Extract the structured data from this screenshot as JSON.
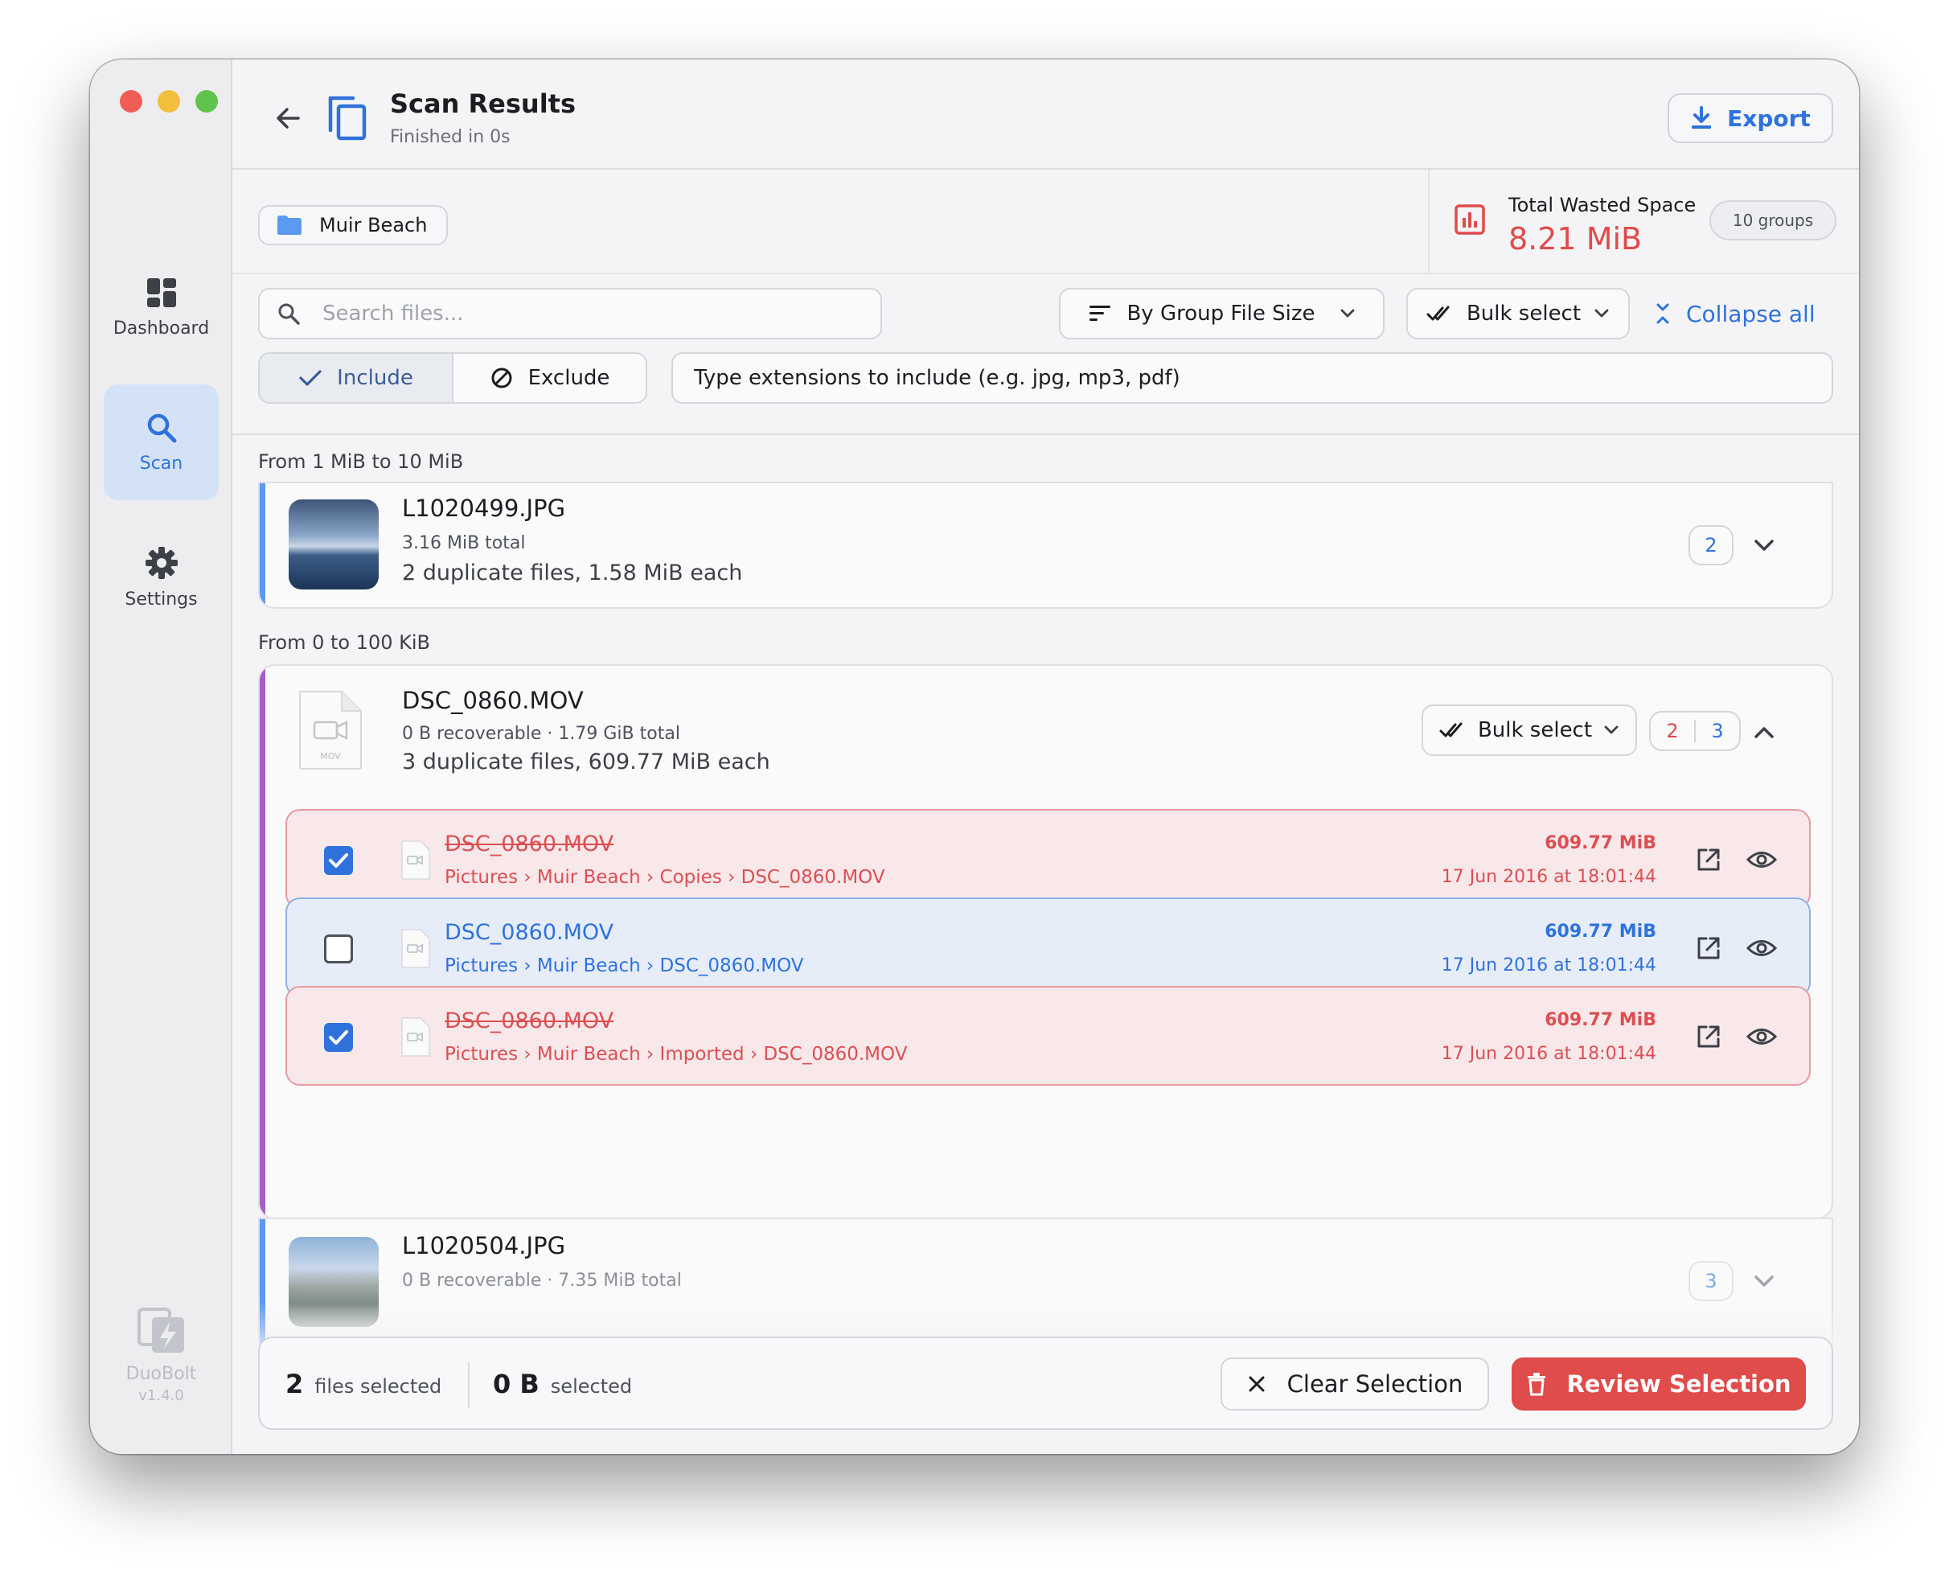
{
  "sidebar": {
    "items": [
      {
        "label": "Dashboard",
        "icon": "dashboard-icon"
      },
      {
        "label": "Scan",
        "icon": "search-icon"
      },
      {
        "label": "Settings",
        "icon": "gear-icon"
      }
    ],
    "brand": {
      "name": "DuoBolt",
      "version": "v1.4.0"
    }
  },
  "header": {
    "title": "Scan Results",
    "subtitle": "Finished in 0s",
    "export_label": "Export"
  },
  "info": {
    "folder": "Muir Beach",
    "wasted_label": "Total Wasted Space",
    "wasted_value": "8.21 MiB",
    "groups": "10 groups"
  },
  "controls": {
    "search_placeholder": "Search files...",
    "sort_label": "By Group File Size",
    "bulk_label": "Bulk select",
    "collapse_label": "Collapse all",
    "include_label": "Include",
    "exclude_label": "Exclude",
    "ext_placeholder": "Type extensions to include (e.g. jpg, mp3, pdf)"
  },
  "list": {
    "sections": [
      "From 1 MiB to 10 MiB",
      "From 0 to 100 KiB"
    ],
    "groups": [
      {
        "name": "L1020499.JPG",
        "meta": "3.16 MiB total",
        "sub": "2 duplicate files, 1.58 MiB each",
        "count": "2"
      },
      {
        "name": "DSC_0860.MOV",
        "meta": "0 B recoverable · 1.79 GiB total",
        "sub": "3 duplicate files, 609.77 MiB each",
        "bulk_label": "Bulk select",
        "count_red": "2",
        "count_blue": "3",
        "thumb_label": "MOV",
        "files": [
          {
            "name": "DSC_0860.MOV",
            "path": "Pictures › Muir Beach › Copies › DSC_0860.MOV",
            "size": "609.77 MiB",
            "date": "17 Jun 2016 at 18:01:44",
            "selected": true
          },
          {
            "name": "DSC_0860.MOV",
            "path": "Pictures › Muir Beach › DSC_0860.MOV",
            "size": "609.77 MiB",
            "date": "17 Jun 2016 at 18:01:44",
            "selected": false
          },
          {
            "name": "DSC_0860.MOV",
            "path": "Pictures › Muir Beach › Imported › DSC_0860.MOV",
            "size": "609.77 MiB",
            "date": "17 Jun 2016 at 18:01:44",
            "selected": true
          }
        ]
      },
      {
        "name": "L1020504.JPG",
        "meta": "0 B recoverable · 7.35 MiB total",
        "count": "3"
      }
    ]
  },
  "footer": {
    "files_count": "2",
    "files_label": "files selected",
    "bytes_value": "0 B",
    "bytes_label": "selected",
    "clear_label": "Clear Selection",
    "review_label": "Review Selection"
  },
  "colors": {
    "accent": "#2f72dc",
    "danger": "#e04b4b",
    "group_accent_blue": "#5b9af0",
    "group_accent_purple": "#a85cc8"
  }
}
